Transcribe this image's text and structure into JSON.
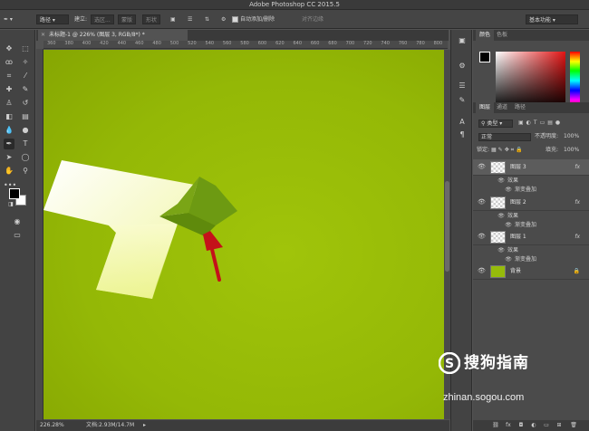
{
  "app": {
    "title": "Adobe Photoshop CC 2015.5"
  },
  "options_bar": {
    "mode_value": "路径",
    "make_label": "建立:",
    "selection_label": "选区...",
    "mask_label": "蒙版",
    "shape_label": "形状",
    "auto_add_delete_label": "自动添加/删除",
    "auto_add_delete_checked": true,
    "align_edges_label": "对齐边缘",
    "workspace_value": "基本功能"
  },
  "document": {
    "tab_label": "未标题-1 @ 226% (图层 3, RGB/8*) *",
    "zoom": "226.28%",
    "doc_size": "文档:2.93M/14.7M"
  },
  "ruler": {
    "top_ticks": [
      "360",
      "380",
      "400",
      "420",
      "440",
      "460",
      "480",
      "500",
      "520",
      "540",
      "560",
      "580",
      "600",
      "620",
      "640",
      "660",
      "680",
      "700",
      "720",
      "740",
      "760",
      "780",
      "800"
    ]
  },
  "color_panel": {
    "tabs": [
      "颜色",
      "色板"
    ],
    "foreground": "#000000",
    "background": "#ffffff",
    "hue_color": "#e21414"
  },
  "layers_panel": {
    "tabs": [
      "图层",
      "通道",
      "路径"
    ],
    "filter_label": "类型",
    "blend_mode": "正常",
    "opacity_label": "不透明度:",
    "opacity_value": "100%",
    "lock_label": "锁定:",
    "fill_label": "填充:",
    "fill_value": "100%",
    "layers": [
      {
        "name": "图层 3",
        "has_fx": true,
        "selected": true,
        "effects_label": "效果",
        "effect": "渐变叠加"
      },
      {
        "name": "图层 2",
        "has_fx": true,
        "selected": false,
        "effects_label": "效果",
        "effect": "渐变叠加"
      },
      {
        "name": "图层 1",
        "has_fx": true,
        "selected": false,
        "effects_label": "效果",
        "effect": "渐变叠加"
      },
      {
        "name": "背景",
        "has_fx": false,
        "selected": false
      }
    ],
    "fx_label": "fx"
  },
  "canvas": {
    "background_color": "#97bb07",
    "arrow_color": "#c4111a"
  },
  "watermark": {
    "brand_text": "搜狗指南",
    "url": "zhinan.sogou.com"
  }
}
